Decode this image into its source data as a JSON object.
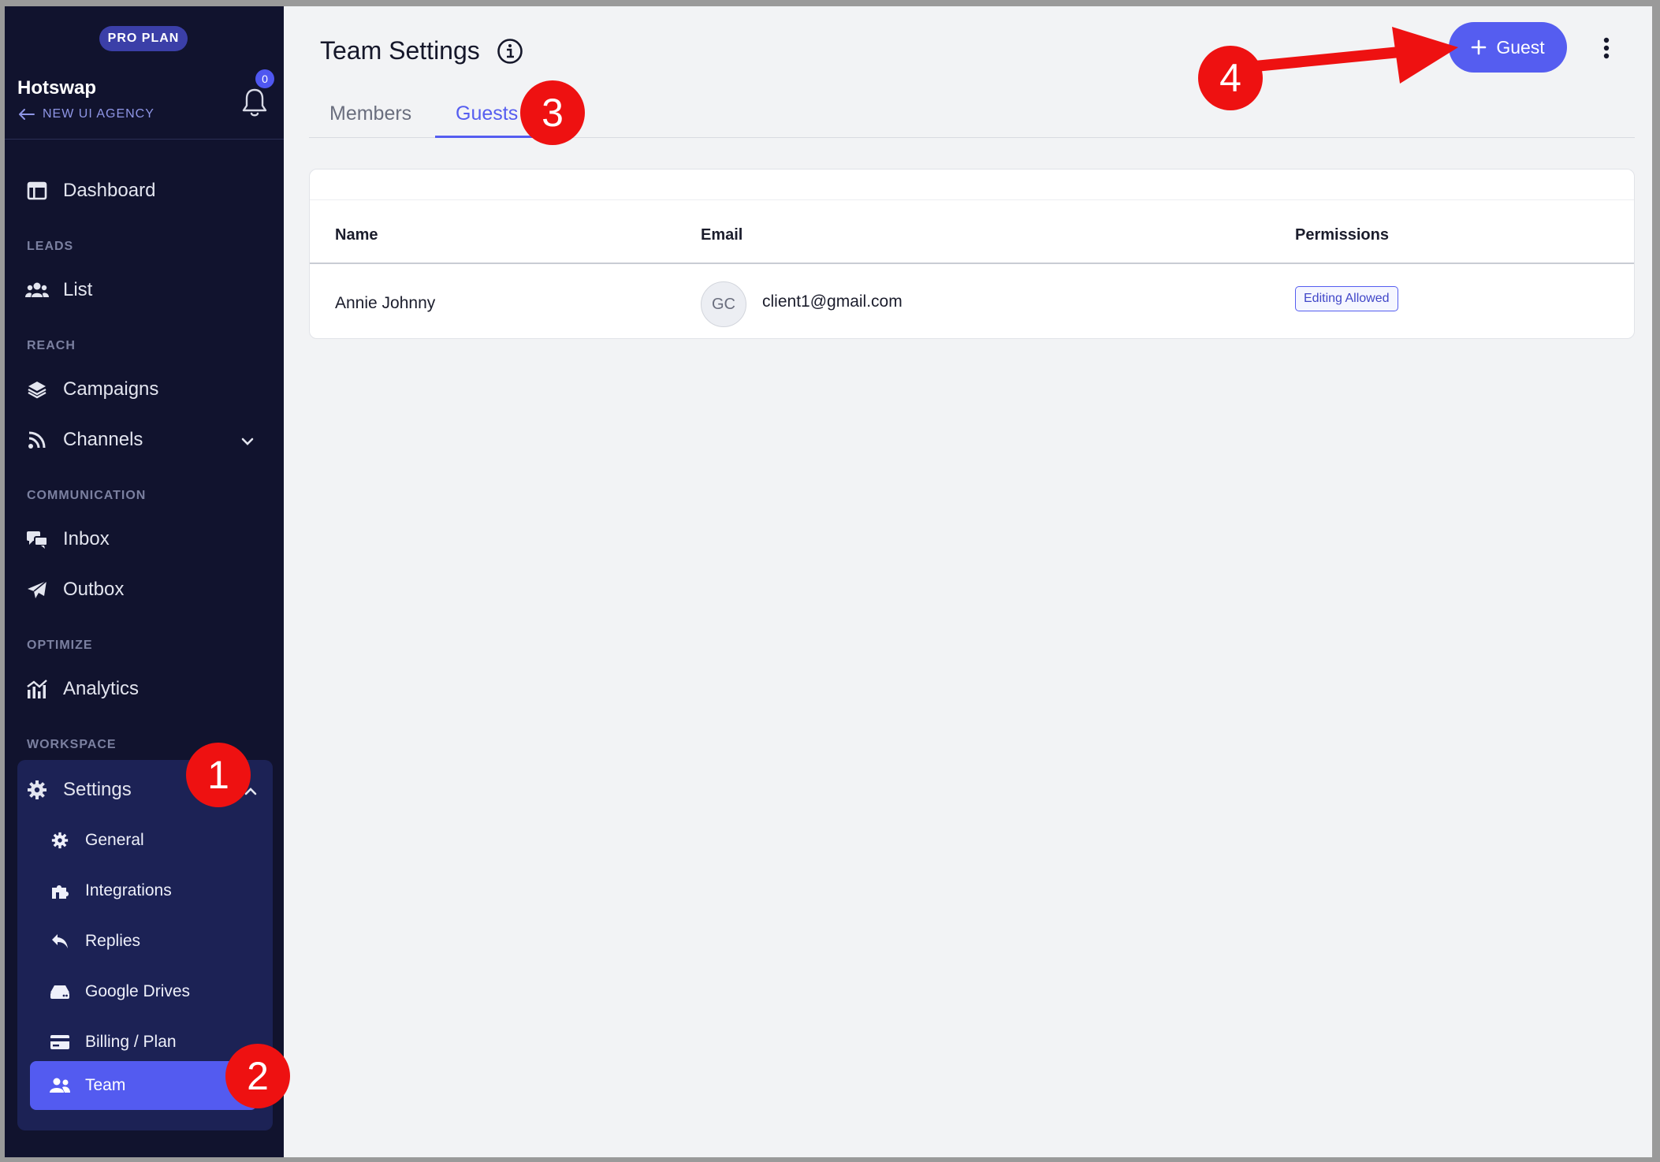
{
  "sidebar": {
    "plan_badge": "PRO PLAN",
    "brand": "Hotswap",
    "agency": "NEW UI AGENCY",
    "notification_count": "0",
    "nav": {
      "dashboard": "Dashboard",
      "leads_label": "LEADS",
      "list": "List",
      "reach_label": "REACH",
      "campaigns": "Campaigns",
      "channels": "Channels",
      "communication_label": "COMMUNICATION",
      "inbox": "Inbox",
      "outbox": "Outbox",
      "optimize_label": "OPTIMIZE",
      "analytics": "Analytics",
      "workspace_label": "WORKSPACE",
      "settings": "Settings"
    },
    "settings_items": {
      "general": "General",
      "integrations": "Integrations",
      "replies": "Replies",
      "google_drives": "Google Drives",
      "billing": "Billing / Plan",
      "team": "Team"
    }
  },
  "header": {
    "title": "Team Settings",
    "guest_button": "Guest"
  },
  "tabs": {
    "members": "Members",
    "guests": "Guests"
  },
  "table": {
    "columns": [
      "Name",
      "Email",
      "Permissions"
    ],
    "rows": [
      {
        "name": "Annie Johnny",
        "avatar": "GC",
        "email": "client1@gmail.com",
        "permission": "Editing Allowed"
      }
    ]
  },
  "annotations": [
    "1",
    "2",
    "3",
    "4"
  ],
  "colors": {
    "sidebar_bg": "#11132e",
    "accent": "#555df0",
    "marker": "#ee1111"
  }
}
